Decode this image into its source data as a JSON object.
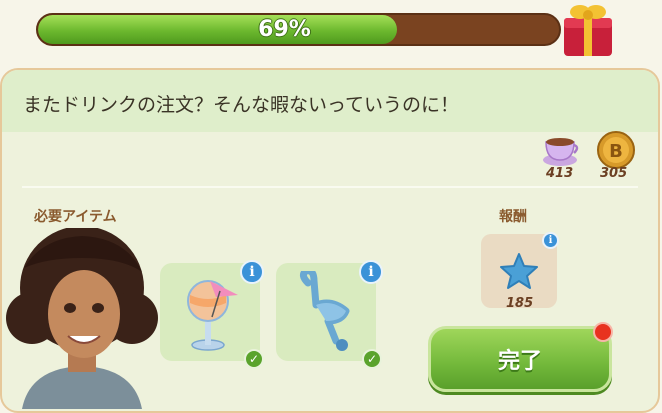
{
  "progress": {
    "value_percent": 69,
    "label": "69%"
  },
  "gift": {
    "icon": "gift-box-icon"
  },
  "dialog": {
    "text": "またドリンクの注文？そんな暇ないっていうのに！"
  },
  "resources": [
    {
      "icon": "teacup-icon",
      "value": "413"
    },
    {
      "icon": "coin-icon",
      "value": "305"
    }
  ],
  "required_items": {
    "label": "必要アイテム",
    "items": [
      {
        "icon": "cocktail-glass-icon",
        "status": "complete"
      },
      {
        "icon": "flamingo-stirrer-icon",
        "status": "complete"
      }
    ]
  },
  "reward": {
    "label": "報酬",
    "icon": "blue-star-icon",
    "value": "185"
  },
  "complete_button": {
    "label": "完了"
  },
  "colors": {
    "accent_green": "#6cb82e",
    "bar_bg": "#7a4320",
    "info_blue": "#3a92d8",
    "badge_red": "#e8321f"
  }
}
